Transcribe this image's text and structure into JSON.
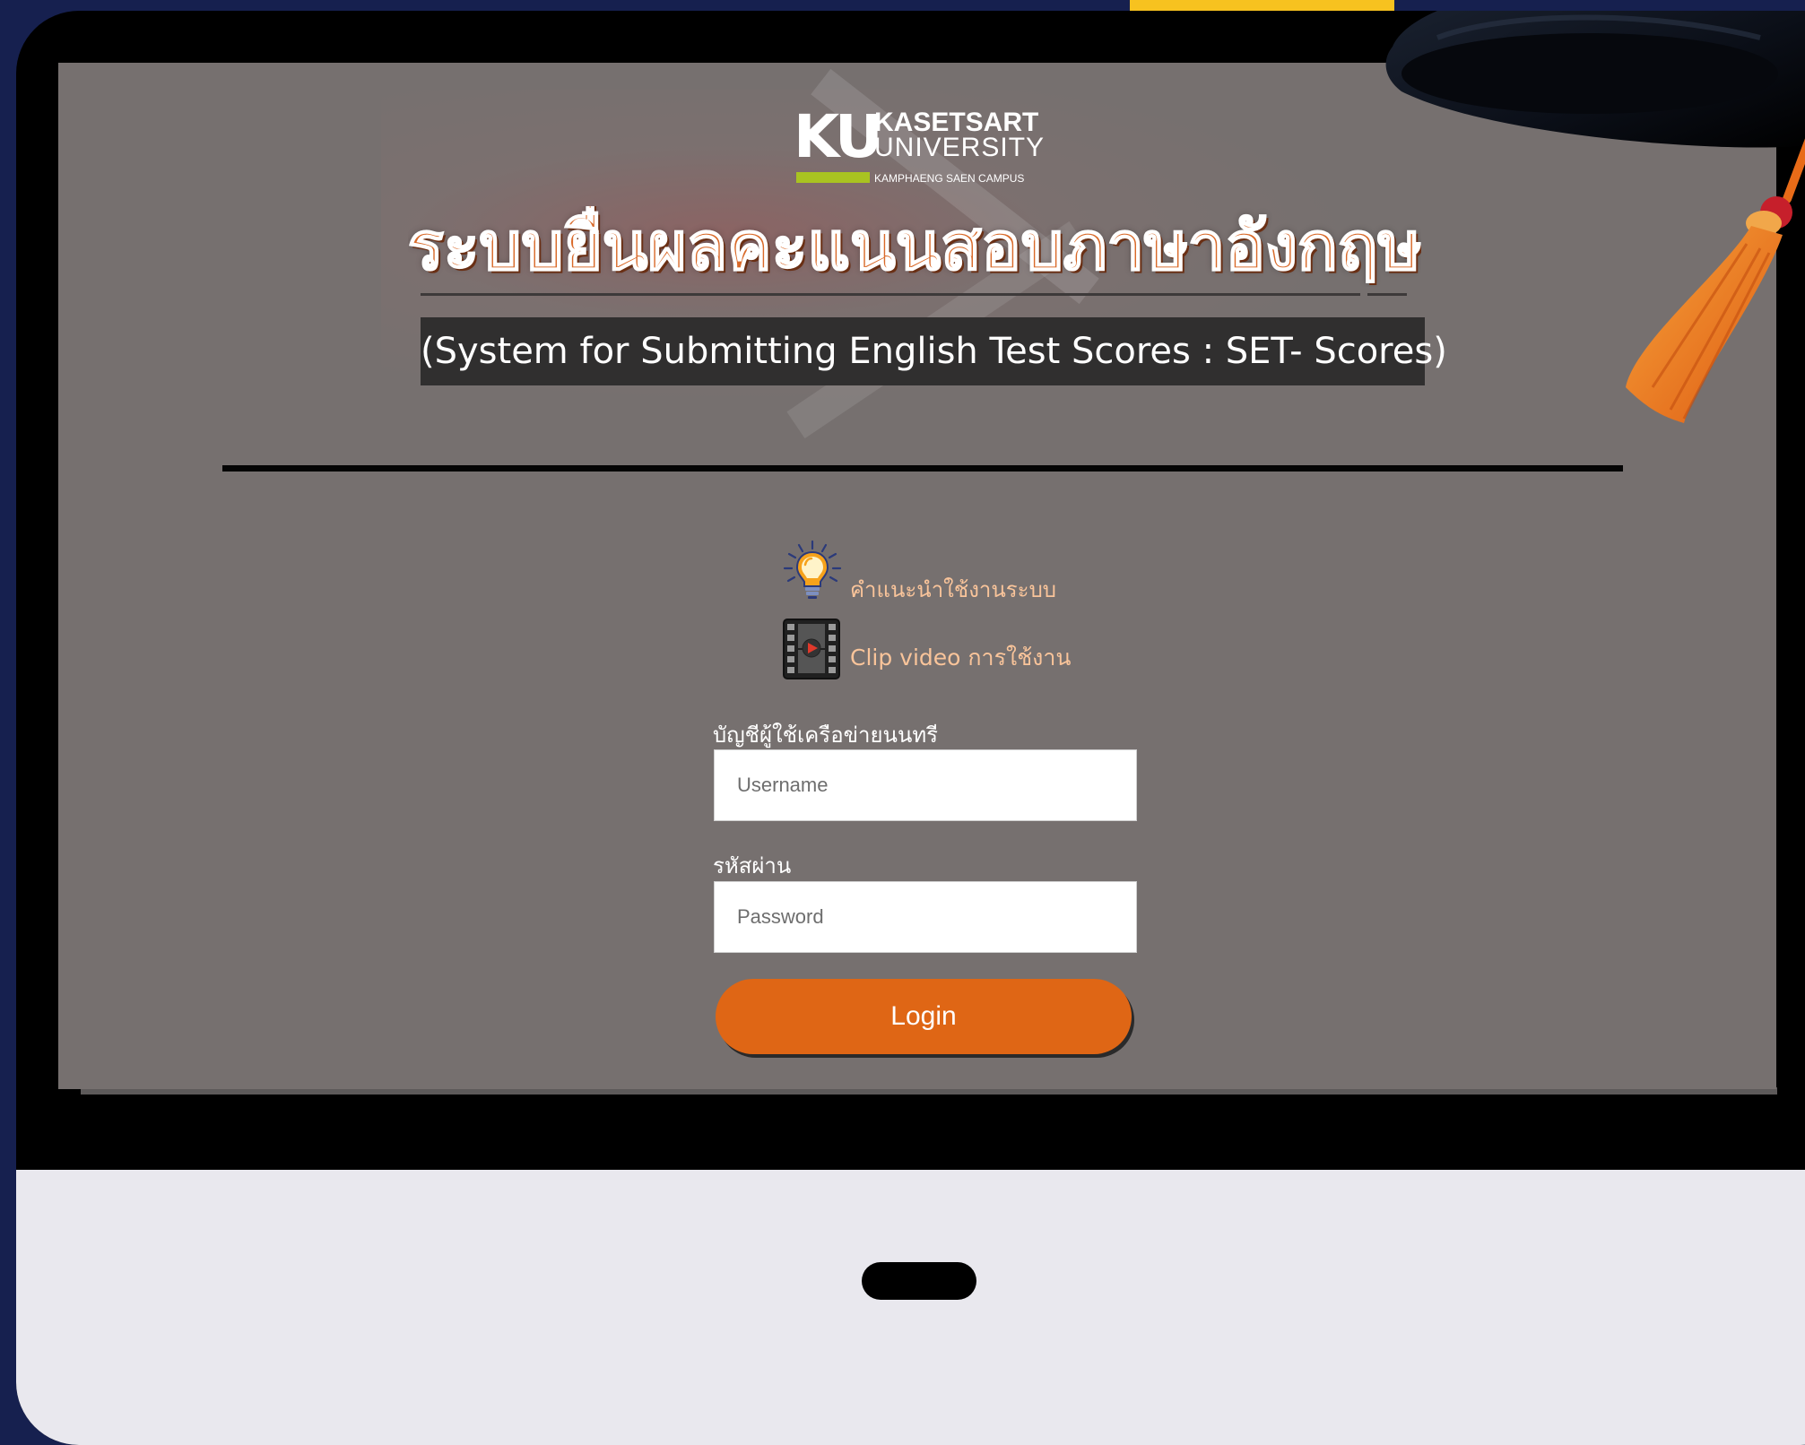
{
  "logo": {
    "mark": "KU",
    "line1": "KASETSART",
    "line2": "UNIVERSITY",
    "line3": "KAMPHAENG SAEN CAMPUS"
  },
  "header": {
    "thai_title": "ระบบยื่นผลคะแนนสอบภาษาอังกฤษ",
    "english_title": "(System for Submitting English Test Scores : SET- Scores)"
  },
  "help": {
    "guide_label": "คำแนะนำใช้งานระบบ",
    "guide_icon": "lightbulb-icon",
    "video_label": "Clip video การใช้งาน",
    "video_icon": "film-play-icon"
  },
  "form": {
    "username_label": "บัญชีผู้ใช้เครือข่ายนนทรี",
    "username_value": "",
    "username_placeholder": "Username",
    "password_label": "รหัสผ่าน",
    "password_value": "",
    "password_placeholder": "Password",
    "login_label": "Login"
  },
  "colors": {
    "accent_orange": "#df6615",
    "screen_gray": "#76706f",
    "page_navy": "#16204f",
    "yellow_accent": "#f7c21f",
    "logo_green": "#a9c321"
  }
}
